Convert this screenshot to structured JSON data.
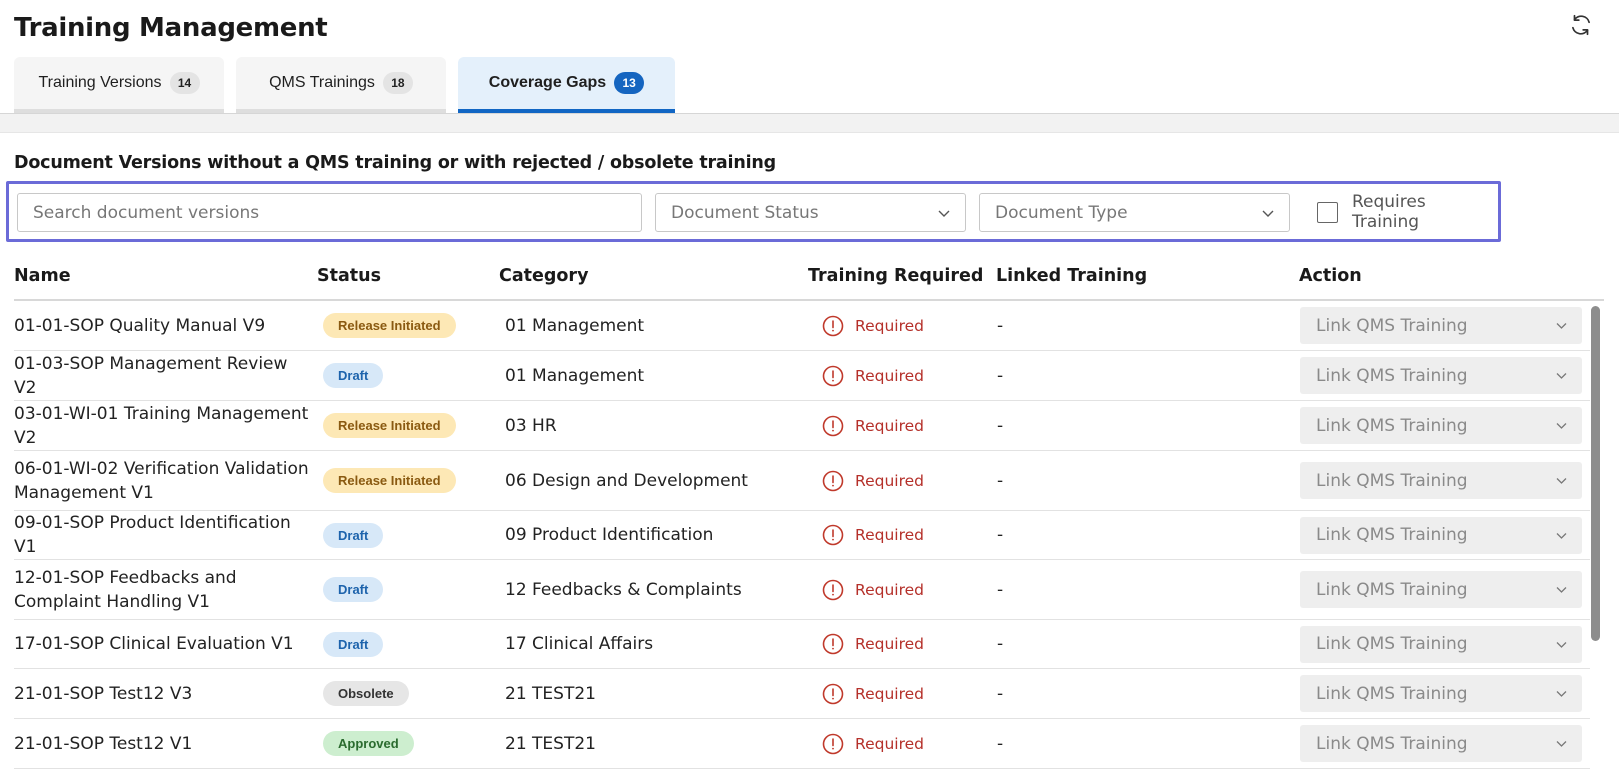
{
  "header": {
    "title": "Training Management",
    "refresh_icon": "refresh-icon"
  },
  "tabs": [
    {
      "label": "Training Versions",
      "count": "14",
      "active": false
    },
    {
      "label": "QMS Trainings",
      "count": "18",
      "active": false
    },
    {
      "label": "Coverage Gaps",
      "count": "13",
      "active": true
    }
  ],
  "section": {
    "title": "Document Versions without a QMS training or with rejected / obsolete training"
  },
  "filters": {
    "search_placeholder": "Search document versions",
    "status_placeholder": "Document Status",
    "type_placeholder": "Document Type",
    "requires_training_label": "Requires Training",
    "requires_training_checked": false
  },
  "table": {
    "columns": {
      "name": "Name",
      "status": "Status",
      "category": "Category",
      "training_required": "Training Required",
      "linked_training": "Linked Training",
      "action": "Action"
    },
    "rows": [
      {
        "name": "01-01-SOP Quality Manual V9",
        "status": "Release Initiated",
        "status_kind": "release",
        "category": "01 Management",
        "required": "Required",
        "linked": "-",
        "action": "Link QMS Training"
      },
      {
        "name": "01-03-SOP Management Review V2",
        "status": "Draft",
        "status_kind": "draft",
        "category": "01 Management",
        "required": "Required",
        "linked": "-",
        "action": "Link QMS Training"
      },
      {
        "name": "03-01-WI-01 Training Management V2",
        "status": "Release Initiated",
        "status_kind": "release",
        "category": "03 HR",
        "required": "Required",
        "linked": "-",
        "action": "Link QMS Training"
      },
      {
        "name": "06-01-WI-02 Verification Validation Management V1",
        "status": "Release Initiated",
        "status_kind": "release",
        "category": "06 Design and Development",
        "required": "Required",
        "linked": "-",
        "action": "Link QMS Training"
      },
      {
        "name": "09-01-SOP Product Identification V1",
        "status": "Draft",
        "status_kind": "draft",
        "category": "09 Product Identification",
        "required": "Required",
        "linked": "-",
        "action": "Link QMS Training"
      },
      {
        "name": "12-01-SOP Feedbacks and Complaint Handling V1",
        "status": "Draft",
        "status_kind": "draft",
        "category": "12 Feedbacks & Complaints",
        "required": "Required",
        "linked": "-",
        "action": "Link QMS Training"
      },
      {
        "name": "17-01-SOP Clinical Evaluation V1",
        "status": "Draft",
        "status_kind": "draft",
        "category": "17 Clinical Affairs",
        "required": "Required",
        "linked": "-",
        "action": "Link QMS Training"
      },
      {
        "name": "21-01-SOP Test12 V3",
        "status": "Obsolete",
        "status_kind": "obsolete",
        "category": "21 TEST21",
        "required": "Required",
        "linked": "-",
        "action": "Link QMS Training"
      },
      {
        "name": "21-01-SOP Test12 V1",
        "status": "Approved",
        "status_kind": "approved",
        "category": "21 TEST21",
        "required": "Required",
        "linked": "-",
        "action": "Link QMS Training"
      }
    ]
  },
  "colors": {
    "accent": "#1565c0",
    "filter_highlight": "#6b6bd8",
    "required_red": "#b5302a"
  }
}
